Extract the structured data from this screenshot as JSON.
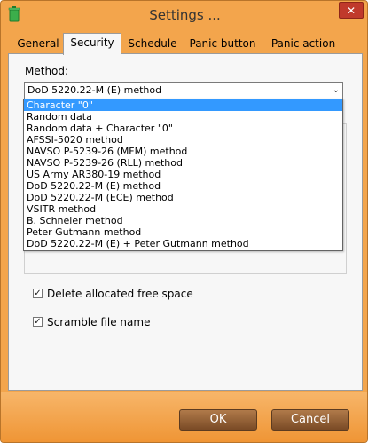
{
  "window": {
    "title": "Settings ...",
    "close_label": "✕"
  },
  "tabs": [
    {
      "label": "General"
    },
    {
      "label": "Security"
    },
    {
      "label": "Schedule"
    },
    {
      "label": "Panic button"
    },
    {
      "label": "Panic action"
    }
  ],
  "security": {
    "method_label": "Method:",
    "selected_method": "DoD 5220.22-M (E) method",
    "methods": [
      "Character \"0\"",
      "Random data",
      "Random data + Character \"0\"",
      "AFSSI-5020 method",
      "NAVSO P-5239-26 (MFM) method",
      "NAVSO P-5239-26 (RLL) method",
      "US Army AR380-19 method",
      "DoD 5220.22-M (E) method",
      "DoD 5220.22-M (ECE) method",
      "VSITR method",
      "B. Schneier method",
      "Peter Gutmann method",
      "DoD 5220.22-M (E) + Peter Gutmann method"
    ],
    "highlighted_method": "Character \"0\"",
    "delete_free_space_label": "Delete allocated free space",
    "delete_free_space_checked": true,
    "scramble_name_label": "Scramble file name",
    "scramble_name_checked": true
  },
  "footer": {
    "ok_label": "OK",
    "cancel_label": "Cancel"
  },
  "colors": {
    "accent": "#f39c3d",
    "selection": "#3399ff",
    "close": "#c0392b"
  }
}
